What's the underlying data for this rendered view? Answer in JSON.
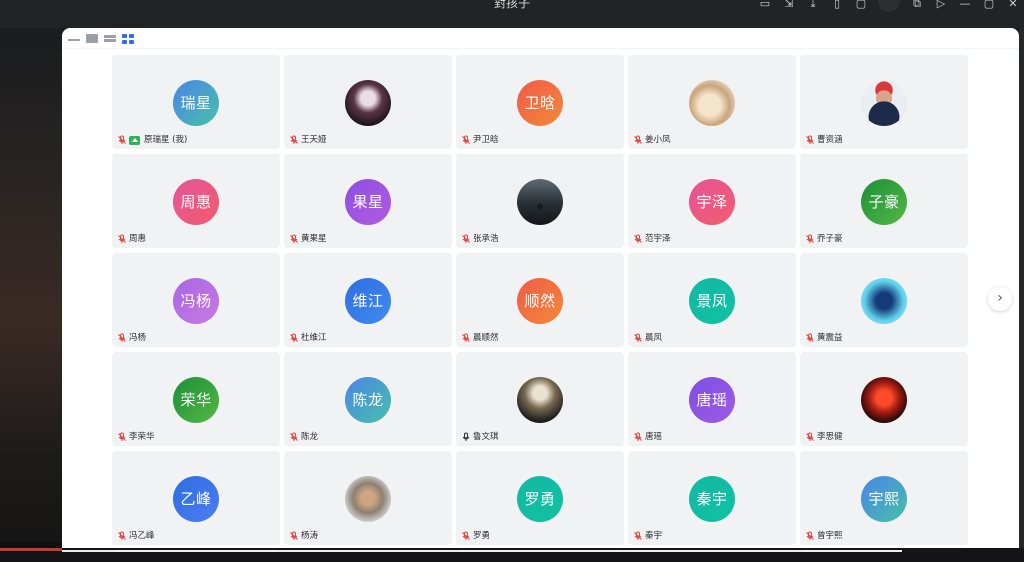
{
  "window": {
    "title": "對孩子",
    "toolbar_icons": [
      "screen-icon",
      "resize-icon",
      "download-icon",
      "clipboard-icon",
      "window-icon",
      "avatar-dot",
      "popout-icon",
      "play-icon",
      "minimize-icon",
      "maximize-icon",
      "close-icon"
    ]
  },
  "view_modes": {
    "icons": [
      "minimize-view-icon",
      "speaker-view-icon",
      "list-view-icon",
      "grid-view-icon"
    ],
    "active": "grid-view-icon"
  },
  "participants": [
    {
      "avatar_text": "瑞星",
      "name": "原瑞星 (我)",
      "muted": true,
      "sharing": true,
      "avatar": "av-g1"
    },
    {
      "avatar_text": "",
      "name": "王天娅",
      "muted": true,
      "sharing": false,
      "avatar": "ph-anime"
    },
    {
      "avatar_text": "卫晗",
      "name": "尹卫晗",
      "muted": true,
      "sharing": false,
      "avatar": "av-orange"
    },
    {
      "avatar_text": "",
      "name": "姜小凤",
      "muted": true,
      "sharing": false,
      "avatar": "ph-cat"
    },
    {
      "avatar_text": "",
      "name": "曹资涵",
      "muted": true,
      "sharing": false,
      "avatar": "ph-man"
    },
    {
      "avatar_text": "周惠",
      "name": "周惠",
      "muted": true,
      "sharing": false,
      "avatar": "av-pink"
    },
    {
      "avatar_text": "果星",
      "name": "黄果星",
      "muted": true,
      "sharing": false,
      "avatar": "av-purple"
    },
    {
      "avatar_text": "",
      "name": "张承浩",
      "muted": true,
      "sharing": false,
      "avatar": "ph-night"
    },
    {
      "avatar_text": "宇泽",
      "name": "范宇泽",
      "muted": true,
      "sharing": false,
      "avatar": "av-pink"
    },
    {
      "avatar_text": "子豪",
      "name": "乔子豪",
      "muted": true,
      "sharing": false,
      "avatar": "av-green"
    },
    {
      "avatar_text": "冯杨",
      "name": "冯杨",
      "muted": true,
      "sharing": false,
      "avatar": "av-lav"
    },
    {
      "avatar_text": "维江",
      "name": "杜维江",
      "muted": true,
      "sharing": false,
      "avatar": "av-blue"
    },
    {
      "avatar_text": "顺然",
      "name": "晨顺然",
      "muted": true,
      "sharing": false,
      "avatar": "av-orange"
    },
    {
      "avatar_text": "景凤",
      "name": "晨凤",
      "muted": true,
      "sharing": false,
      "avatar": "av-teal"
    },
    {
      "avatar_text": "",
      "name": "黄震益",
      "muted": true,
      "sharing": false,
      "avatar": "ph-blue"
    },
    {
      "avatar_text": "荣华",
      "name": "李荣华",
      "muted": true,
      "sharing": false,
      "avatar": "av-green"
    },
    {
      "avatar_text": "陈龙",
      "name": "陈龙",
      "muted": true,
      "sharing": false,
      "avatar": "av-g1"
    },
    {
      "avatar_text": "",
      "name": "鲁文琪",
      "muted": false,
      "sharing": false,
      "avatar": "ph-guitar"
    },
    {
      "avatar_text": "唐瑶",
      "name": "唐瑶",
      "muted": true,
      "sharing": false,
      "avatar": "av-violet"
    },
    {
      "avatar_text": "",
      "name": "李思健",
      "muted": true,
      "sharing": false,
      "avatar": "ph-red"
    },
    {
      "avatar_text": "乙峰",
      "name": "冯乙峰",
      "muted": true,
      "sharing": false,
      "avatar": "av-bluemix"
    },
    {
      "avatar_text": "",
      "name": "杨涛",
      "muted": true,
      "sharing": false,
      "avatar": "ph-selfie"
    },
    {
      "avatar_text": "罗勇",
      "name": "罗勇",
      "muted": true,
      "sharing": false,
      "avatar": "av-teal"
    },
    {
      "avatar_text": "秦宇",
      "name": "秦宇",
      "muted": true,
      "sharing": false,
      "avatar": "av-teal"
    },
    {
      "avatar_text": "宇熙",
      "name": "曾宇熙",
      "muted": true,
      "sharing": false,
      "avatar": "av-g1"
    }
  ],
  "pager": {
    "glyph": "›",
    "icon": "chevron-right-icon"
  },
  "colors": {
    "accent": "#2f6de1",
    "muted_icon": "#e2453c",
    "unmuted_icon": "#2c2c2c",
    "share_badge": "#2fb35a"
  }
}
